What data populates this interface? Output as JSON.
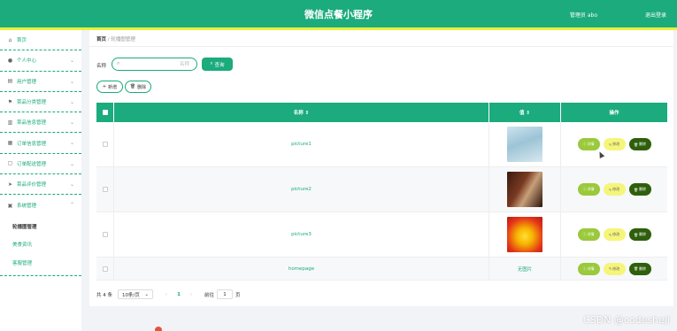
{
  "header": {
    "title": "微信点餐小程序",
    "user": "管理员 abo",
    "logout": "退出登录"
  },
  "sidebar": {
    "items": [
      {
        "label": "首页",
        "icon": "home-icon"
      },
      {
        "label": "个人中心",
        "icon": "user-icon"
      },
      {
        "label": "用户管理",
        "icon": "list-icon"
      },
      {
        "label": "菜品分类管理",
        "icon": "flag-icon"
      },
      {
        "label": "菜品信息管理",
        "icon": "chart-icon"
      },
      {
        "label": "订单信息管理",
        "icon": "order-icon"
      },
      {
        "label": "订单配送管理",
        "icon": "box-icon"
      },
      {
        "label": "菜品评价管理",
        "icon": "send-icon"
      },
      {
        "label": "系统管理",
        "icon": "settings-icon"
      }
    ],
    "subitems": [
      "轮播图管理",
      "美食资讯",
      "客服管理"
    ]
  },
  "breadcrumb": {
    "home": "首页",
    "sep": "/",
    "current": "轮播图管理"
  },
  "search": {
    "label": "名称",
    "placeholder": "名称",
    "button": "查询"
  },
  "actions": {
    "add": "新增",
    "delete": "删除"
  },
  "table": {
    "headers": [
      "名称 ⇕",
      "值 ⇕",
      "操作"
    ],
    "rows": [
      {
        "name": "picture1",
        "value": ""
      },
      {
        "name": "picture2",
        "value": ""
      },
      {
        "name": "picture3",
        "value": ""
      },
      {
        "name": "homepage",
        "value": "无图片"
      }
    ],
    "row_buttons": {
      "detail": "详情",
      "edit": "修改",
      "remove": "删除"
    }
  },
  "pager": {
    "total": "共 4 条",
    "size": "10条/页",
    "page": "1",
    "goto_prefix": "前往",
    "goto_value": "1",
    "goto_suffix": "页"
  },
  "watermark": "CSDN @codesheji",
  "colors": {
    "primary": "#1bab7c",
    "accent_strip": "#e7f03c",
    "detail": "#9ac93c",
    "edit": "#f5f57a",
    "remove": "#2e5f0c"
  }
}
